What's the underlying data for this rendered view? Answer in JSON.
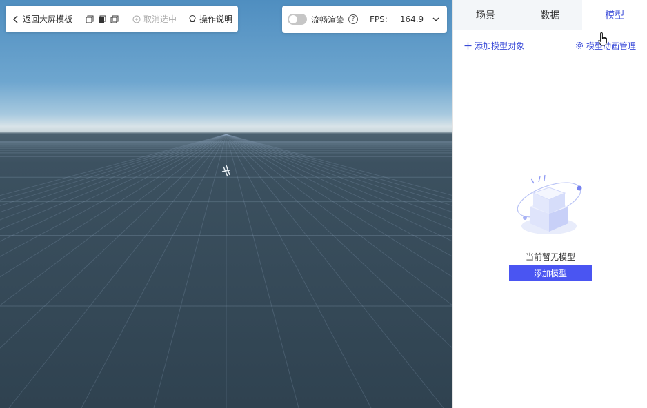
{
  "toolbar": {
    "back_label": "返回大屏模板",
    "cancel_select_label": "取消选中",
    "help_label": "操作说明",
    "icons": [
      "back-arrow-icon",
      "view-2d-icon",
      "view-3d-icon",
      "view-copy-icon",
      "cancel-select-icon",
      "bulb-icon"
    ]
  },
  "render": {
    "smooth_label": "流畅渲染",
    "smooth_enabled": false,
    "help_symbol": "?",
    "fps_label": "FPS:",
    "fps_value": "164.9"
  },
  "panel": {
    "tabs": [
      {
        "label": "场景",
        "active": false
      },
      {
        "label": "数据",
        "active": false
      },
      {
        "label": "模型",
        "active": true
      }
    ],
    "add_object_label": "添加模型对象",
    "manage_label": "模型动画管理",
    "empty_text": "当前暂无模型",
    "add_button_label": "添加模型"
  },
  "colors": {
    "accent": "#3a4bd8",
    "button": "#4a55f2"
  }
}
